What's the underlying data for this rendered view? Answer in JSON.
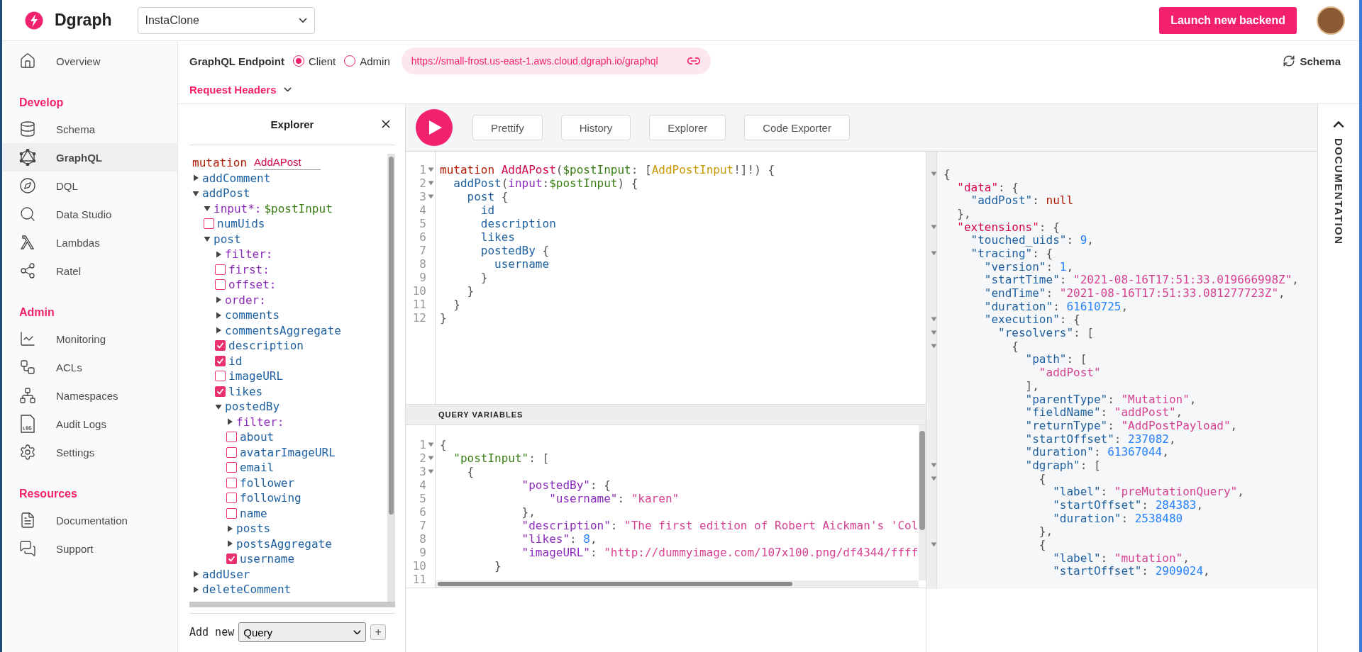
{
  "header": {
    "brand": "Dgraph",
    "project": "InstaClone",
    "launch_button": "Launch new backend"
  },
  "sidebar": {
    "groups": [
      {
        "items": [
          {
            "label": "Overview",
            "selected": false
          }
        ]
      },
      {
        "heading": "Develop",
        "items": [
          {
            "label": "Schema",
            "selected": false
          },
          {
            "label": "GraphQL",
            "selected": true
          },
          {
            "label": "DQL",
            "selected": false
          },
          {
            "label": "Data Studio",
            "selected": false
          },
          {
            "label": "Lambdas",
            "selected": false
          },
          {
            "label": "Ratel",
            "selected": false
          }
        ]
      },
      {
        "heading": "Admin",
        "items": [
          {
            "label": "Monitoring",
            "selected": false
          },
          {
            "label": "ACLs",
            "selected": false
          },
          {
            "label": "Namespaces",
            "selected": false
          },
          {
            "label": "Audit Logs",
            "selected": false
          },
          {
            "label": "Settings",
            "selected": false
          }
        ]
      },
      {
        "heading": "Resources",
        "items": [
          {
            "label": "Documentation",
            "selected": false
          },
          {
            "label": "Support",
            "selected": false
          }
        ]
      }
    ]
  },
  "endpoint": {
    "label": "GraphQL Endpoint",
    "options": [
      {
        "label": "Client",
        "selected": true
      },
      {
        "label": "Admin",
        "selected": false
      }
    ],
    "url": "https://small-frost.us-east-1.aws.cloud.dgraph.io/graphql",
    "schema_button": "Schema",
    "request_headers": "Request Headers"
  },
  "explorer": {
    "title": "Explorer",
    "operation": {
      "keyword": "mutation",
      "name": "AddAPost"
    },
    "fields": [
      {
        "label": "addComment",
        "kind": "branch",
        "argument": false,
        "expanded": false
      },
      {
        "label": "addPost",
        "kind": "branch",
        "argument": false,
        "expanded": true,
        "children": [
          {
            "label": "input*:",
            "value": "$postInput",
            "kind": "branch",
            "argument": true,
            "expanded": true
          },
          {
            "label": "numUids",
            "kind": "leaf",
            "argument": false,
            "checked": false
          },
          {
            "label": "post",
            "kind": "branch",
            "argument": false,
            "expanded": true,
            "children": [
              {
                "label": "filter:",
                "kind": "branch",
                "argument": true,
                "expanded": false
              },
              {
                "label": "first:",
                "kind": "leaf",
                "argument": true,
                "checked": false
              },
              {
                "label": "offset:",
                "kind": "leaf",
                "argument": true,
                "checked": false
              },
              {
                "label": "order:",
                "kind": "branch",
                "argument": true,
                "expanded": false
              },
              {
                "label": "comments",
                "kind": "branch",
                "argument": false,
                "expanded": false
              },
              {
                "label": "commentsAggregate",
                "kind": "branch",
                "argument": false,
                "expanded": false
              },
              {
                "label": "description",
                "kind": "leaf",
                "argument": false,
                "checked": true
              },
              {
                "label": "id",
                "kind": "leaf",
                "argument": false,
                "checked": true
              },
              {
                "label": "imageURL",
                "kind": "leaf",
                "argument": false,
                "checked": false
              },
              {
                "label": "likes",
                "kind": "leaf",
                "argument": false,
                "checked": true
              },
              {
                "label": "postedBy",
                "kind": "branch",
                "argument": false,
                "expanded": true,
                "children": [
                  {
                    "label": "filter:",
                    "kind": "branch",
                    "argument": true,
                    "expanded": false
                  },
                  {
                    "label": "about",
                    "kind": "leaf",
                    "argument": false,
                    "checked": false
                  },
                  {
                    "label": "avatarImageURL",
                    "kind": "leaf",
                    "argument": false,
                    "checked": false
                  },
                  {
                    "label": "email",
                    "kind": "leaf",
                    "argument": false,
                    "checked": false
                  },
                  {
                    "label": "follower",
                    "kind": "leaf",
                    "argument": false,
                    "checked": false
                  },
                  {
                    "label": "following",
                    "kind": "leaf",
                    "argument": false,
                    "checked": false
                  },
                  {
                    "label": "name",
                    "kind": "leaf",
                    "argument": false,
                    "checked": false
                  },
                  {
                    "label": "posts",
                    "kind": "branch",
                    "argument": false,
                    "expanded": false
                  },
                  {
                    "label": "postsAggregate",
                    "kind": "branch",
                    "argument": false,
                    "expanded": false
                  },
                  {
                    "label": "username",
                    "kind": "leaf",
                    "argument": false,
                    "checked": true
                  }
                ]
              }
            ]
          }
        ]
      },
      {
        "label": "addUser",
        "kind": "branch",
        "argument": false,
        "expanded": false
      },
      {
        "label": "deleteComment",
        "kind": "branch",
        "argument": false,
        "expanded": false
      }
    ],
    "add_new": {
      "label": "Add new",
      "select": "Query",
      "button": "+"
    }
  },
  "toolbar": {
    "buttons": [
      "Prettify",
      "History",
      "Explorer",
      "Code Exporter"
    ]
  },
  "query_editor": {
    "lines": [
      {
        "n": "1",
        "fold": true,
        "tokens": [
          {
            "kind": "keyword",
            "text": "mutation"
          },
          {
            "kind": "definition",
            "text": " AddAPost"
          },
          {
            "kind": "punctuation",
            "text": "("
          },
          {
            "kind": "variable",
            "text": "$postInput"
          },
          {
            "kind": "punctuation",
            "text": ": ["
          },
          {
            "kind": "type",
            "text": "AddPostInput"
          },
          {
            "kind": "punctuation",
            "text": "!]!) {"
          }
        ]
      },
      {
        "n": "2",
        "fold": true,
        "tokens": [
          {
            "kind": "property",
            "text": "  addPost"
          },
          {
            "kind": "punctuation",
            "text": "("
          },
          {
            "kind": "attribute",
            "text": "input"
          },
          {
            "kind": "punctuation",
            "text": ":"
          },
          {
            "kind": "variable",
            "text": "$postInput"
          },
          {
            "kind": "punctuation",
            "text": ") {"
          }
        ]
      },
      {
        "n": "3",
        "fold": true,
        "tokens": [
          {
            "kind": "property",
            "text": "    post"
          },
          {
            "kind": "punctuation",
            "text": " {"
          }
        ]
      },
      {
        "n": "4",
        "fold": false,
        "tokens": [
          {
            "kind": "property",
            "text": "      id"
          }
        ]
      },
      {
        "n": "5",
        "fold": false,
        "tokens": [
          {
            "kind": "property",
            "text": "      description"
          }
        ]
      },
      {
        "n": "6",
        "fold": false,
        "tokens": [
          {
            "kind": "property",
            "text": "      likes"
          }
        ]
      },
      {
        "n": "7",
        "fold": false,
        "tokens": [
          {
            "kind": "property",
            "text": "      postedBy"
          },
          {
            "kind": "punctuation",
            "text": " {"
          }
        ]
      },
      {
        "n": "8",
        "fold": false,
        "tokens": [
          {
            "kind": "property",
            "text": "        username"
          }
        ]
      },
      {
        "n": "9",
        "fold": false,
        "tokens": [
          {
            "kind": "punctuation",
            "text": "      }"
          }
        ]
      },
      {
        "n": "10",
        "fold": false,
        "tokens": [
          {
            "kind": "punctuation",
            "text": "    }"
          }
        ]
      },
      {
        "n": "11",
        "fold": false,
        "tokens": [
          {
            "kind": "punctuation",
            "text": "  }"
          }
        ]
      },
      {
        "n": "12",
        "fold": false,
        "tokens": [
          {
            "kind": "punctuation",
            "text": "}"
          }
        ]
      }
    ]
  },
  "variables": {
    "title": "QUERY VARIABLES",
    "lines": [
      {
        "n": "1",
        "fold": true,
        "tokens": [
          {
            "kind": "punctuation",
            "text": "{"
          }
        ]
      },
      {
        "n": "2",
        "fold": true,
        "tokens": [
          {
            "kind": "variable",
            "text": "  \"postInput\""
          },
          {
            "kind": "punctuation",
            "text": ": ["
          }
        ]
      },
      {
        "n": "3",
        "fold": true,
        "tokens": [
          {
            "kind": "punctuation",
            "text": "    {"
          }
        ]
      },
      {
        "n": "4",
        "fold": false,
        "tokens": [
          {
            "kind": "attribute",
            "text": "            \"postedBy\""
          },
          {
            "kind": "punctuation",
            "text": ": {"
          }
        ]
      },
      {
        "n": "5",
        "fold": false,
        "tokens": [
          {
            "kind": "attribute",
            "text": "                \"username\""
          },
          {
            "kind": "punctuation",
            "text": ": "
          },
          {
            "kind": "string",
            "text": "\"karen\""
          }
        ]
      },
      {
        "n": "6",
        "fold": false,
        "tokens": [
          {
            "kind": "punctuation",
            "text": "            },"
          }
        ]
      },
      {
        "n": "7",
        "fold": false,
        "tokens": [
          {
            "kind": "attribute",
            "text": "            \"description\""
          },
          {
            "kind": "punctuation",
            "text": ": "
          },
          {
            "kind": "string",
            "text": "\"The first edition of Robert Aickman's 'Col"
          }
        ]
      },
      {
        "n": "8",
        "fold": false,
        "tokens": [
          {
            "kind": "attribute",
            "text": "            \"likes\""
          },
          {
            "kind": "punctuation",
            "text": ": "
          },
          {
            "kind": "number",
            "text": "8"
          },
          {
            "kind": "punctuation",
            "text": ","
          }
        ]
      },
      {
        "n": "9",
        "fold": false,
        "tokens": [
          {
            "kind": "attribute",
            "text": "            \"imageURL\""
          },
          {
            "kind": "punctuation",
            "text": ": "
          },
          {
            "kind": "string",
            "text": "\"http://dummyimage.com/107x100.png/df4344/ffff"
          }
        ]
      },
      {
        "n": "10",
        "fold": false,
        "tokens": [
          {
            "kind": "punctuation",
            "text": "        }"
          }
        ]
      },
      {
        "n": "11",
        "fold": false
      }
    ]
  },
  "result": {
    "lines": [
      {
        "fold": true,
        "tokens": [
          {
            "kind": "punctuation",
            "text": "{"
          }
        ]
      },
      {
        "fold": false,
        "tokens": [
          {
            "kind": "key",
            "text": "  \"data\""
          },
          {
            "kind": "punctuation",
            "text": ": {"
          }
        ]
      },
      {
        "fold": false,
        "tokens": [
          {
            "kind": "property",
            "text": "    \"addPost\""
          },
          {
            "kind": "punctuation",
            "text": ": "
          },
          {
            "kind": "keyword",
            "text": "null"
          }
        ]
      },
      {
        "fold": false,
        "tokens": [
          {
            "kind": "punctuation",
            "text": "  },"
          }
        ]
      },
      {
        "fold": true,
        "tokens": [
          {
            "kind": "key",
            "text": "  \"extensions\""
          },
          {
            "kind": "punctuation",
            "text": ": {"
          }
        ]
      },
      {
        "fold": false,
        "tokens": [
          {
            "kind": "property",
            "text": "    \"touched_uids\""
          },
          {
            "kind": "punctuation",
            "text": ": "
          },
          {
            "kind": "number",
            "text": "9"
          },
          {
            "kind": "punctuation",
            "text": ","
          }
        ]
      },
      {
        "fold": true,
        "tokens": [
          {
            "kind": "property",
            "text": "    \"tracing\""
          },
          {
            "kind": "punctuation",
            "text": ": {"
          }
        ]
      },
      {
        "fold": false,
        "tokens": [
          {
            "kind": "property",
            "text": "      \"version\""
          },
          {
            "kind": "punctuation",
            "text": ": "
          },
          {
            "kind": "number",
            "text": "1"
          },
          {
            "kind": "punctuation",
            "text": ","
          }
        ]
      },
      {
        "fold": false,
        "tokens": [
          {
            "kind": "property",
            "text": "      \"startTime\""
          },
          {
            "kind": "punctuation",
            "text": ": "
          },
          {
            "kind": "string",
            "text": "\"2021-08-16T17:51:33.019666998Z\""
          },
          {
            "kind": "punctuation",
            "text": ","
          }
        ]
      },
      {
        "fold": false,
        "tokens": [
          {
            "kind": "property",
            "text": "      \"endTime\""
          },
          {
            "kind": "punctuation",
            "text": ": "
          },
          {
            "kind": "string",
            "text": "\"2021-08-16T17:51:33.081277723Z\""
          },
          {
            "kind": "punctuation",
            "text": ","
          }
        ]
      },
      {
        "fold": false,
        "tokens": [
          {
            "kind": "property",
            "text": "      \"duration\""
          },
          {
            "kind": "punctuation",
            "text": ": "
          },
          {
            "kind": "number",
            "text": "61610725"
          },
          {
            "kind": "punctuation",
            "text": ","
          }
        ]
      },
      {
        "fold": true,
        "tokens": [
          {
            "kind": "property",
            "text": "      \"execution\""
          },
          {
            "kind": "punctuation",
            "text": ": {"
          }
        ]
      },
      {
        "fold": true,
        "tokens": [
          {
            "kind": "property",
            "text": "        \"resolvers\""
          },
          {
            "kind": "punctuation",
            "text": ": ["
          }
        ]
      },
      {
        "fold": true,
        "tokens": [
          {
            "kind": "punctuation",
            "text": "          {"
          }
        ]
      },
      {
        "fold": false,
        "tokens": [
          {
            "kind": "property",
            "text": "            \"path\""
          },
          {
            "kind": "punctuation",
            "text": ": ["
          }
        ]
      },
      {
        "fold": false,
        "tokens": [
          {
            "kind": "string",
            "text": "              \"addPost\""
          }
        ]
      },
      {
        "fold": false,
        "tokens": [
          {
            "kind": "punctuation",
            "text": "            ],"
          }
        ]
      },
      {
        "fold": false,
        "tokens": [
          {
            "kind": "property",
            "text": "            \"parentType\""
          },
          {
            "kind": "punctuation",
            "text": ": "
          },
          {
            "kind": "string",
            "text": "\"Mutation\""
          },
          {
            "kind": "punctuation",
            "text": ","
          }
        ]
      },
      {
        "fold": false,
        "tokens": [
          {
            "kind": "property",
            "text": "            \"fieldName\""
          },
          {
            "kind": "punctuation",
            "text": ": "
          },
          {
            "kind": "string",
            "text": "\"addPost\""
          },
          {
            "kind": "punctuation",
            "text": ","
          }
        ]
      },
      {
        "fold": false,
        "tokens": [
          {
            "kind": "property",
            "text": "            \"returnType\""
          },
          {
            "kind": "punctuation",
            "text": ": "
          },
          {
            "kind": "string",
            "text": "\"AddPostPayload\""
          },
          {
            "kind": "punctuation",
            "text": ","
          }
        ]
      },
      {
        "fold": false,
        "tokens": [
          {
            "kind": "property",
            "text": "            \"startOffset\""
          },
          {
            "kind": "punctuation",
            "text": ": "
          },
          {
            "kind": "number",
            "text": "237082"
          },
          {
            "kind": "punctuation",
            "text": ","
          }
        ]
      },
      {
        "fold": false,
        "tokens": [
          {
            "kind": "property",
            "text": "            \"duration\""
          },
          {
            "kind": "punctuation",
            "text": ": "
          },
          {
            "kind": "number",
            "text": "61367044"
          },
          {
            "kind": "punctuation",
            "text": ","
          }
        ]
      },
      {
        "fold": true,
        "tokens": [
          {
            "kind": "property",
            "text": "            \"dgraph\""
          },
          {
            "kind": "punctuation",
            "text": ": ["
          }
        ]
      },
      {
        "fold": true,
        "tokens": [
          {
            "kind": "punctuation",
            "text": "              {"
          }
        ]
      },
      {
        "fold": false,
        "tokens": [
          {
            "kind": "property",
            "text": "                \"label\""
          },
          {
            "kind": "punctuation",
            "text": ": "
          },
          {
            "kind": "string",
            "text": "\"preMutationQuery\""
          },
          {
            "kind": "punctuation",
            "text": ","
          }
        ]
      },
      {
        "fold": false,
        "tokens": [
          {
            "kind": "property",
            "text": "                \"startOffset\""
          },
          {
            "kind": "punctuation",
            "text": ": "
          },
          {
            "kind": "number",
            "text": "284383"
          },
          {
            "kind": "punctuation",
            "text": ","
          }
        ]
      },
      {
        "fold": false,
        "tokens": [
          {
            "kind": "property",
            "text": "                \"duration\""
          },
          {
            "kind": "punctuation",
            "text": ": "
          },
          {
            "kind": "number",
            "text": "2538480"
          }
        ]
      },
      {
        "fold": false,
        "tokens": [
          {
            "kind": "punctuation",
            "text": "              },"
          }
        ]
      },
      {
        "fold": true,
        "tokens": [
          {
            "kind": "punctuation",
            "text": "              {"
          }
        ]
      },
      {
        "fold": false,
        "tokens": [
          {
            "kind": "property",
            "text": "                \"label\""
          },
          {
            "kind": "punctuation",
            "text": ": "
          },
          {
            "kind": "string",
            "text": "\"mutation\""
          },
          {
            "kind": "punctuation",
            "text": ","
          }
        ]
      },
      {
        "fold": false,
        "tokens": [
          {
            "kind": "property",
            "text": "                \"startOffset\""
          },
          {
            "kind": "punctuation",
            "text": ": "
          },
          {
            "kind": "number",
            "text": "2909024"
          },
          {
            "kind": "punctuation",
            "text": ","
          }
        ]
      }
    ]
  },
  "docs": {
    "label": "DOCUMENTATION"
  }
}
